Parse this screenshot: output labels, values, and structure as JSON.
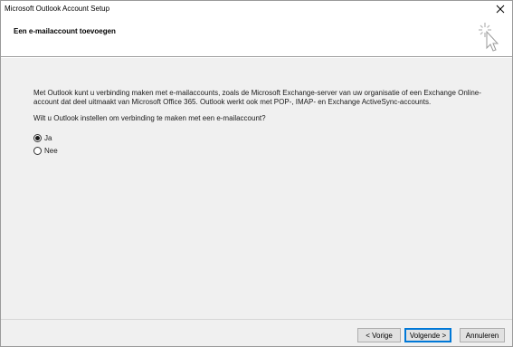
{
  "window": {
    "title": "Microsoft Outlook Account Setup",
    "close_icon": "close-icon"
  },
  "header": {
    "heading": "Een e-mailaccount toevoegen",
    "icon": "cursor-click-icon"
  },
  "main": {
    "description": "Met Outlook kunt u verbinding maken met e-mailaccounts, zoals de Microsoft Exchange-server van uw organisatie of een Exchange Online-account dat deel uitmaakt van Microsoft Office 365. Outlook werkt ook met POP-, IMAP- en Exchange ActiveSync-accounts.",
    "question": "Wilt u Outlook instellen om verbinding te maken met een e-mailaccount?",
    "options": [
      {
        "label": "Ja",
        "selected": true
      },
      {
        "label": "Nee",
        "selected": false
      }
    ]
  },
  "footer": {
    "back_label": "< Vorige",
    "next_label": "Volgende >",
    "cancel_label": "Annuleren"
  },
  "colors": {
    "content_bg": "#f0f0f0",
    "primary_border": "#0078d7",
    "button_bg": "#e1e1e1"
  }
}
